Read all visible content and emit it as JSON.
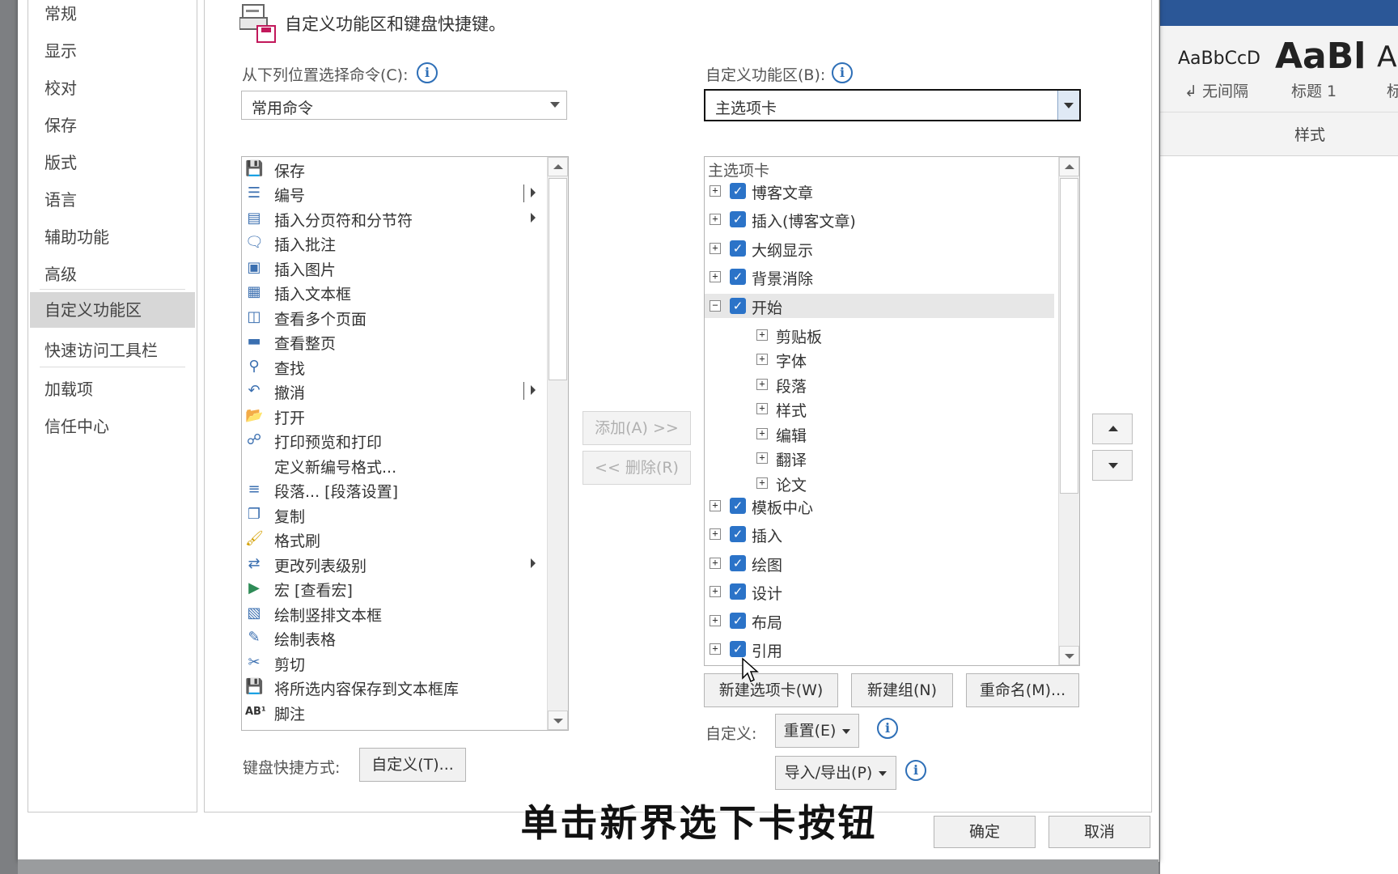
{
  "dialog": {
    "header": "自定义功能区和键盘快捷键。",
    "sidebar": {
      "items": [
        {
          "label": "常规"
        },
        {
          "label": "显示"
        },
        {
          "label": "校对"
        },
        {
          "label": "保存"
        },
        {
          "label": "版式"
        },
        {
          "label": "语言"
        },
        {
          "label": "辅助功能"
        },
        {
          "label": "高级"
        },
        {
          "label": "自定义功能区",
          "selected": true
        },
        {
          "label": "快速访问工具栏"
        },
        {
          "label": "加载项"
        },
        {
          "label": "信任中心"
        }
      ]
    },
    "left": {
      "label": "从下列位置选择命令(C):",
      "combo_value": "常用命令",
      "commands": [
        {
          "label": "保存",
          "icon": "save-icon"
        },
        {
          "label": "编号",
          "icon": "numbering-icon"
        },
        {
          "label": "插入分页符和分节符",
          "icon": "page-break-icon"
        },
        {
          "label": "插入批注",
          "icon": "comment-icon"
        },
        {
          "label": "插入图片",
          "icon": "picture-icon"
        },
        {
          "label": "插入文本框",
          "icon": "textbox-icon"
        },
        {
          "label": "查看多个页面",
          "icon": "multi-page-icon"
        },
        {
          "label": "查看整页",
          "icon": "one-page-icon"
        },
        {
          "label": "查找",
          "icon": "find-icon"
        },
        {
          "label": "撤消",
          "icon": "undo-icon"
        },
        {
          "label": "打开",
          "icon": "folder-open-icon"
        },
        {
          "label": "打印预览和打印",
          "icon": "print-preview-icon"
        },
        {
          "label": "定义新编号格式...",
          "icon": ""
        },
        {
          "label": "段落... [段落设置]",
          "icon": "paragraph-icon"
        },
        {
          "label": "复制",
          "icon": "copy-icon"
        },
        {
          "label": "格式刷",
          "icon": "format-painter-icon"
        },
        {
          "label": "更改列表级别",
          "icon": "list-level-icon"
        },
        {
          "label": "宏 [查看宏]",
          "icon": "macro-play-icon"
        },
        {
          "label": "绘制竖排文本框",
          "icon": "vertical-textbox-icon"
        },
        {
          "label": "绘制表格",
          "icon": "draw-table-icon"
        },
        {
          "label": "剪切",
          "icon": "scissors-icon"
        },
        {
          "label": "将所选内容保存到文本框库",
          "icon": "save-selection-icon"
        },
        {
          "label": "脚注",
          "icon": "footnote-icon"
        }
      ],
      "keyboard_label": "键盘快捷方式:",
      "keyboard_button": "自定义(T)..."
    },
    "middle": {
      "add_button": "添加(A) >>",
      "remove_button": "<< 删除(R)"
    },
    "right": {
      "label": "自定义功能区(B):",
      "combo_value": "主选项卡",
      "tree_header": "主选项卡",
      "tabs_top": [
        "博客文章",
        "插入(博客文章)",
        "大纲显示",
        "背景消除"
      ],
      "expanded_tab": "开始",
      "groups": [
        "剪贴板",
        "字体",
        "段落",
        "样式",
        "编辑",
        "翻译",
        "论文"
      ],
      "tabs_bottom": [
        "模板中心",
        "插入",
        "绘图",
        "设计",
        "布局",
        "引用"
      ],
      "new_tab_button": "新建选项卡(W)",
      "new_group_button": "新建组(N)",
      "rename_button": "重命名(M)...",
      "custom_label": "自定义:",
      "reset_button": "重置(E)",
      "import_export_button": "导入/导出(P)"
    },
    "ok_button": "确定",
    "cancel_button": "取消"
  },
  "word_ribbon": {
    "styles": [
      {
        "sample": "AaBbCcD",
        "name": "↲ 无间隔"
      },
      {
        "sample": "AaBl",
        "name": "标题 1"
      },
      {
        "sample": "A",
        "name": "标"
      }
    ],
    "group_label": "样式"
  },
  "caption": "单击新界选下卡按钮",
  "colors": {
    "checkbox": "#2b73c8",
    "info": "#2e6fb7",
    "word_blue": "#2b5797"
  }
}
